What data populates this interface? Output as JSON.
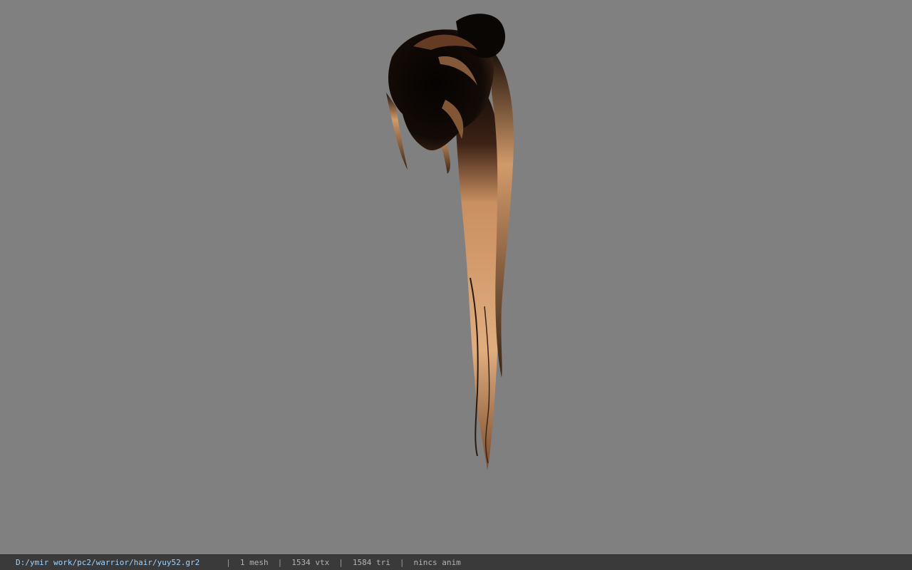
{
  "viewport": {
    "background_color": "#808080",
    "subject": "hair-model"
  },
  "statusbar": {
    "file_path": "D:/ymir work/pc2/warrior/hair/yuy52.gr2",
    "separator": "|",
    "mesh_count": "1 mesh",
    "vertex_count": "1534 vtx",
    "triangle_count": "1584 tri",
    "anim_status": "nincs anim"
  },
  "colors": {
    "hair_light": "#d6a070",
    "hair_dark": "#0c0705",
    "path_text": "#9fd3ff",
    "statusbar_bg": "#3a3a3a"
  }
}
